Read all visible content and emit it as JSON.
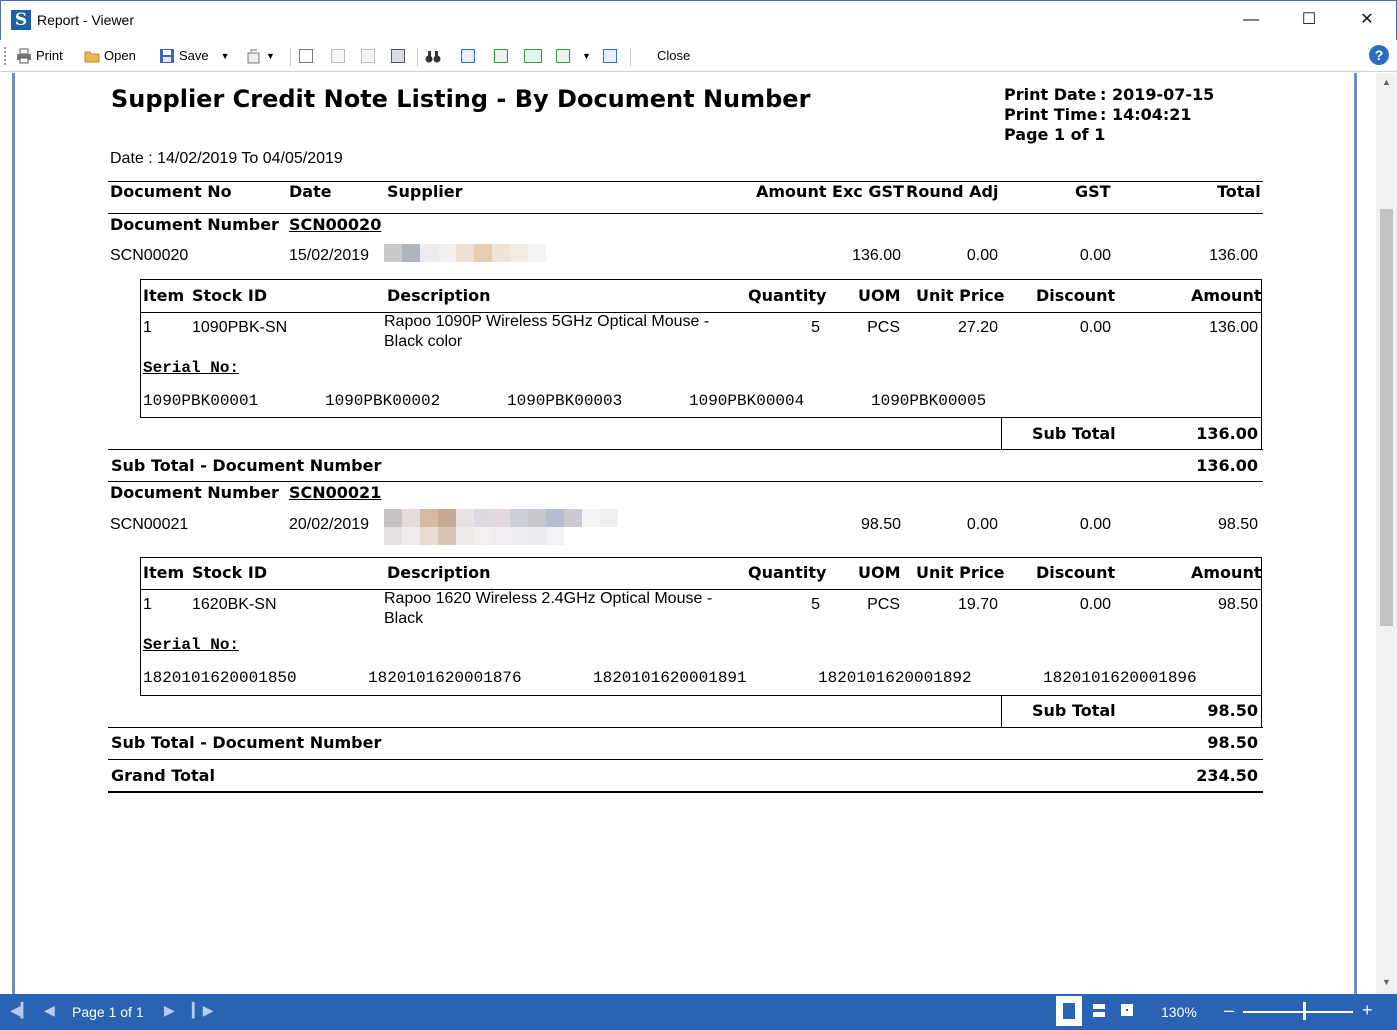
{
  "window": {
    "title": "Report - Viewer",
    "icon": "S"
  },
  "toolbar": {
    "print": "Print",
    "open": "Open",
    "save": "Save",
    "close": "Close",
    "help": "?"
  },
  "report": {
    "title": "Supplier Credit Note Listing - By Document Number",
    "print_date_label": "Print Date",
    "print_date": ": 2019-07-15",
    "print_time_label": "Print Time",
    "print_time": ": 14:04:21",
    "page_info": "Page 1 of 1",
    "date_range": "Date : 14/02/2019 To 04/05/2019",
    "columns": {
      "doc_no": "Document No",
      "date": "Date",
      "supplier": "Supplier",
      "amount": "Amount Exc GST",
      "round_adj": "Round Adj",
      "gst": "GST",
      "total": "Total"
    },
    "detail_columns": {
      "item": "Item",
      "stock_id": "Stock ID",
      "description": "Description",
      "quantity": "Quantity",
      "uom": "UOM",
      "unit_price": "Unit Price",
      "discount": "Discount",
      "amount": "Amount"
    },
    "group_label": "Document Number",
    "serial_label": "Serial No:",
    "sub_total_label": "Sub Total",
    "group_sub_total_label": "Sub Total - Document Number",
    "grand_total_label": "Grand Total",
    "grand_total": "234.50",
    "documents": [
      {
        "group_value": "SCN00020",
        "doc_no": "SCN00020",
        "date": "15/02/2019",
        "amount": "136.00",
        "round_adj": "0.00",
        "gst": "0.00",
        "total": "136.00",
        "item": {
          "no": "1",
          "stock_id": "1090PBK-SN",
          "desc1": "Rapoo 1090P Wireless 5GHz Optical Mouse -",
          "desc2": "Black color",
          "quantity": "5",
          "uom": "PCS",
          "unit_price": "27.20",
          "discount": "0.00",
          "amount": "136.00"
        },
        "serials": [
          "1090PBK00001",
          "1090PBK00002",
          "1090PBK00003",
          "1090PBK00004",
          "1090PBK00005"
        ],
        "sub_total": "136.00",
        "group_sub_total": "136.00"
      },
      {
        "group_value": "SCN00021",
        "doc_no": "SCN00021",
        "date": "20/02/2019",
        "amount": "98.50",
        "round_adj": "0.00",
        "gst": "0.00",
        "total": "98.50",
        "item": {
          "no": "1",
          "stock_id": "1620BK-SN",
          "desc1": "Rapoo 1620 Wireless 2.4GHz Optical Mouse -",
          "desc2": "Black",
          "quantity": "5",
          "uom": "PCS",
          "unit_price": "19.70",
          "discount": "0.00",
          "amount": "98.50"
        },
        "serials": [
          "1820101620001850",
          "1820101620001876",
          "1820101620001891",
          "1820101620001892",
          "1820101620001896"
        ],
        "sub_total": "98.50",
        "group_sub_total": "98.50"
      }
    ]
  },
  "statusbar": {
    "page": "Page 1 of 1",
    "zoom": "130%"
  },
  "colors": {
    "statusbar": "#2a63b3",
    "accent": "#2b6cc4"
  }
}
